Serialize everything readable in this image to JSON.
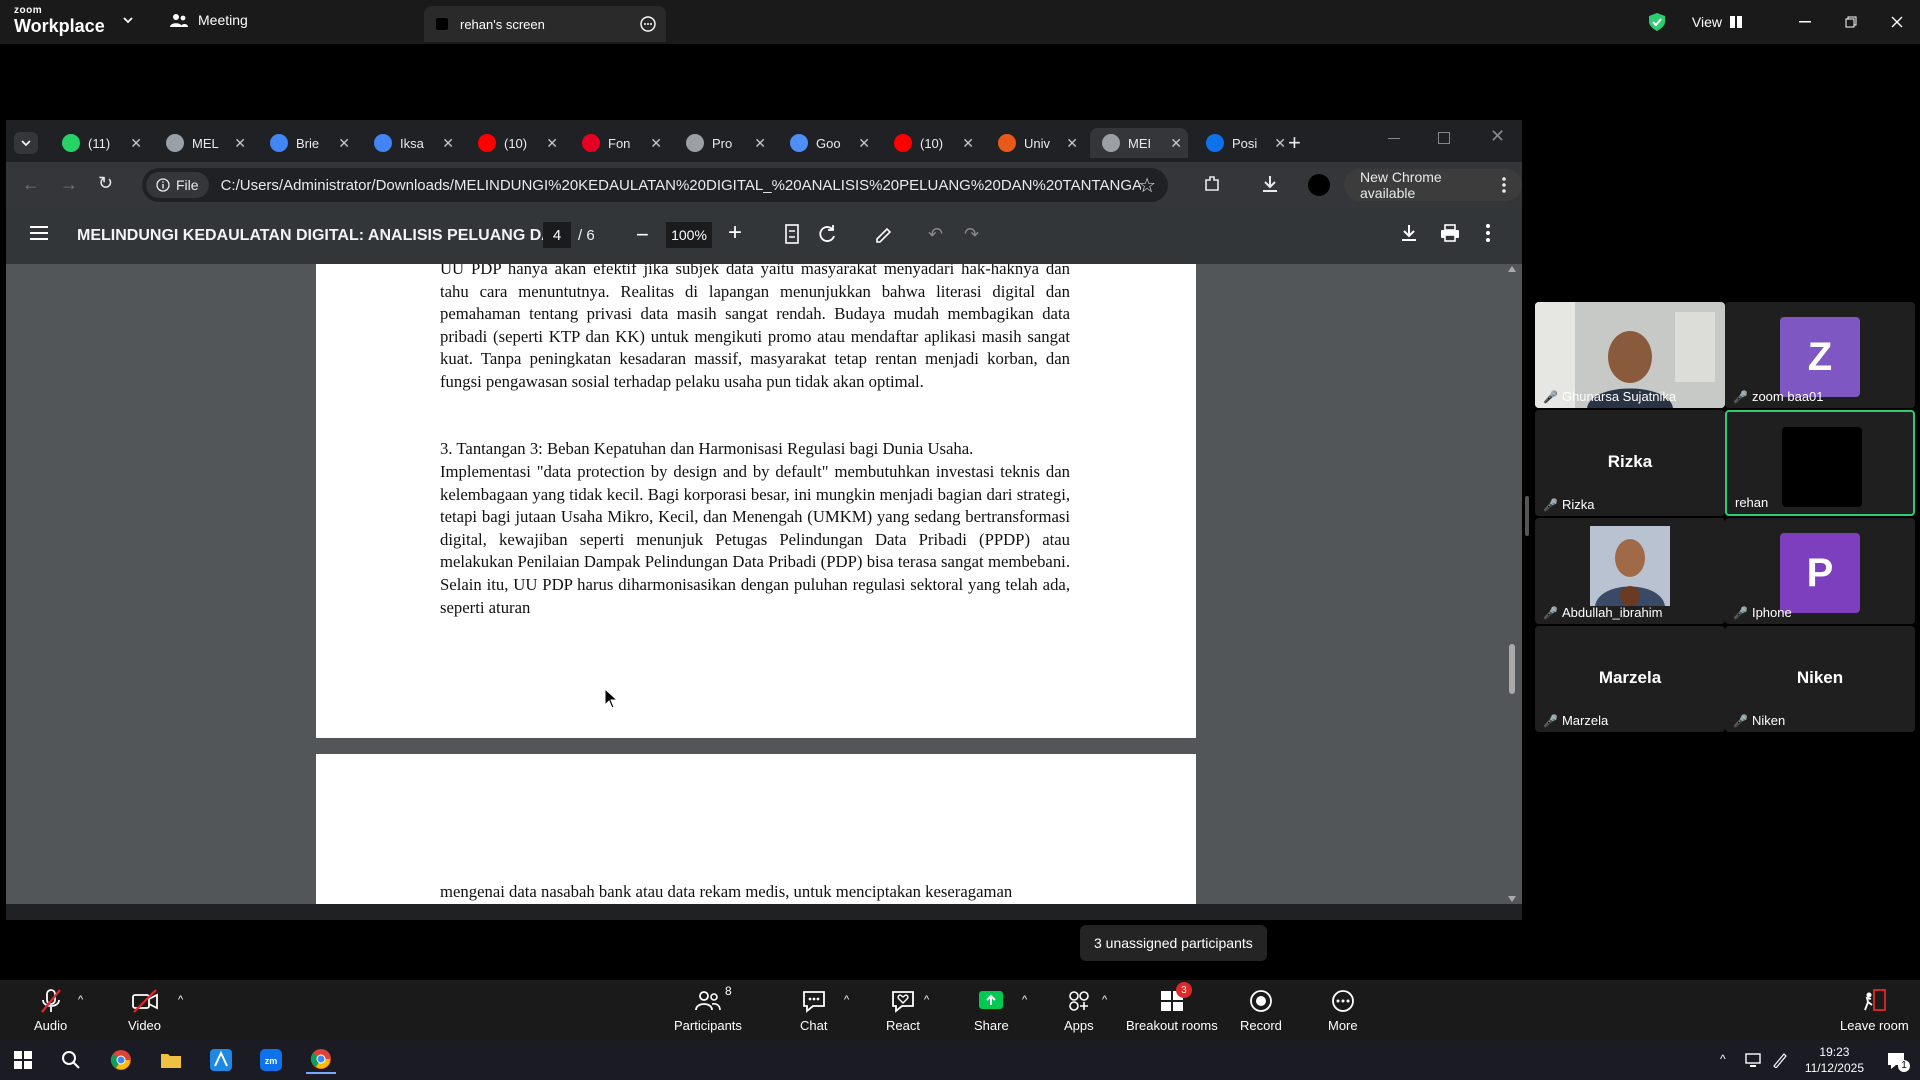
{
  "zoom": {
    "logo_small": "zoom",
    "logo_big": "Workplace",
    "meeting_label": "Meeting",
    "screen_tab_label": "rehan's screen",
    "view_label": "View"
  },
  "chrome": {
    "tabs": [
      {
        "label": "(11)",
        "icon": "whatsapp-icon"
      },
      {
        "label": "MEL",
        "icon": "globe-icon"
      },
      {
        "label": "Brie",
        "icon": "docs-icon"
      },
      {
        "label": "Iksa",
        "icon": "docs-icon"
      },
      {
        "label": "(10)",
        "icon": "youtube-icon"
      },
      {
        "label": "Fon",
        "icon": "pinterest-icon"
      },
      {
        "label": "Pro",
        "icon": "chatgpt-icon"
      },
      {
        "label": "Goo",
        "icon": "gemini-icon"
      },
      {
        "label": "(10)",
        "icon": "youtube-icon"
      },
      {
        "label": "Univ",
        "icon": "blogger-icon"
      },
      {
        "label": "MEI",
        "icon": "globe-icon"
      },
      {
        "label": "Posi",
        "icon": "zm-icon"
      }
    ],
    "file_chip": "File",
    "url": "C:/Users/Administrator/Downloads/MELINDUNGI%20KEDAULATAN%20DIGITAL_%20ANALISIS%20PELUANG%20DAN%20TANTANGA...",
    "update_label": "New Chrome available"
  },
  "pdf": {
    "title": "MELINDUNGI KEDAULATAN DIGITAL: ANALISIS PELUANG DA...",
    "page_current": "4",
    "page_total": "/ 6",
    "zoom": "100%",
    "para1": "UU PDP hanya akan efektif jika subjek data yaitu masyarakat menyadari hak-haknya dan tahu cara menuntutnya. Realitas di lapangan menunjukkan bahwa literasi digital dan pemahaman tentang privasi data masih sangat rendah. Budaya mudah membagikan data pribadi (seperti KTP dan KK) untuk mengikuti promo atau mendaftar aplikasi masih sangat kuat. Tanpa peningkatan kesadaran massif, masyarakat tetap rentan menjadi korban, dan fungsi pengawasan sosial terhadap pelaku usaha pun tidak akan optimal.",
    "heading3": "3. Tantangan 3: Beban Kepatuhan dan Harmonisasi Regulasi bagi Dunia Usaha.",
    "para2": "Implementasi \"data protection by design and by default\" membutuhkan investasi teknis dan kelembagaan yang tidak kecil. Bagi korporasi besar, ini mungkin menjadi bagian dari strategi, tetapi bagi jutaan Usaha Mikro, Kecil, dan Menengah (UMKM) yang sedang bertransformasi digital, kewajiban seperti menunjuk Petugas Pelindungan Data Pribadi (PPDP) atau melakukan Penilaian Dampak Pelindungan Data Pribadi (PDP) bisa terasa sangat membebani. Selain itu, UU PDP harus diharmonisasikan dengan puluhan regulasi sektoral yang telah ada, seperti aturan",
    "next_page_line": "mengenai data nasabah bank atau data rekam medis, untuk menciptakan keseragaman"
  },
  "participants": [
    {
      "name": "Ghunarsa Sujatnika",
      "type": "video",
      "big": ""
    },
    {
      "name": "zoom baa01",
      "type": "avatar",
      "initial": "Z",
      "color": "#7e57c2",
      "big": ""
    },
    {
      "name": "Rizka",
      "type": "name",
      "big": "Rizka"
    },
    {
      "name": "rehan",
      "type": "black",
      "big": ""
    },
    {
      "name": "Abdullah_ibrahim",
      "type": "photo",
      "big": ""
    },
    {
      "name": "Iphone",
      "type": "avatar",
      "initial": "P",
      "color": "#7e3fbf",
      "big": ""
    },
    {
      "name": "Marzela",
      "type": "name",
      "big": "Marzela"
    },
    {
      "name": "Niken",
      "type": "name",
      "big": "Niken"
    }
  ],
  "tooltip": "3 unassigned participants",
  "toolbar": {
    "audio": "Audio",
    "video": "Video",
    "participants": "Participants",
    "participants_count": "8",
    "chat": "Chat",
    "react": "React",
    "share": "Share",
    "apps": "Apps",
    "breakout": "Breakout rooms",
    "breakout_badge": "3",
    "record": "Record",
    "more": "More",
    "leave": "Leave room"
  },
  "taskbar": {
    "time": "19:23",
    "date": "11/12/2025",
    "notif_count": "1"
  },
  "colors": {
    "zoom_accent": "#0e72ed",
    "share_green": "#00c853",
    "active_speaker": "#2ecc71",
    "mic_off": "#e02828"
  }
}
